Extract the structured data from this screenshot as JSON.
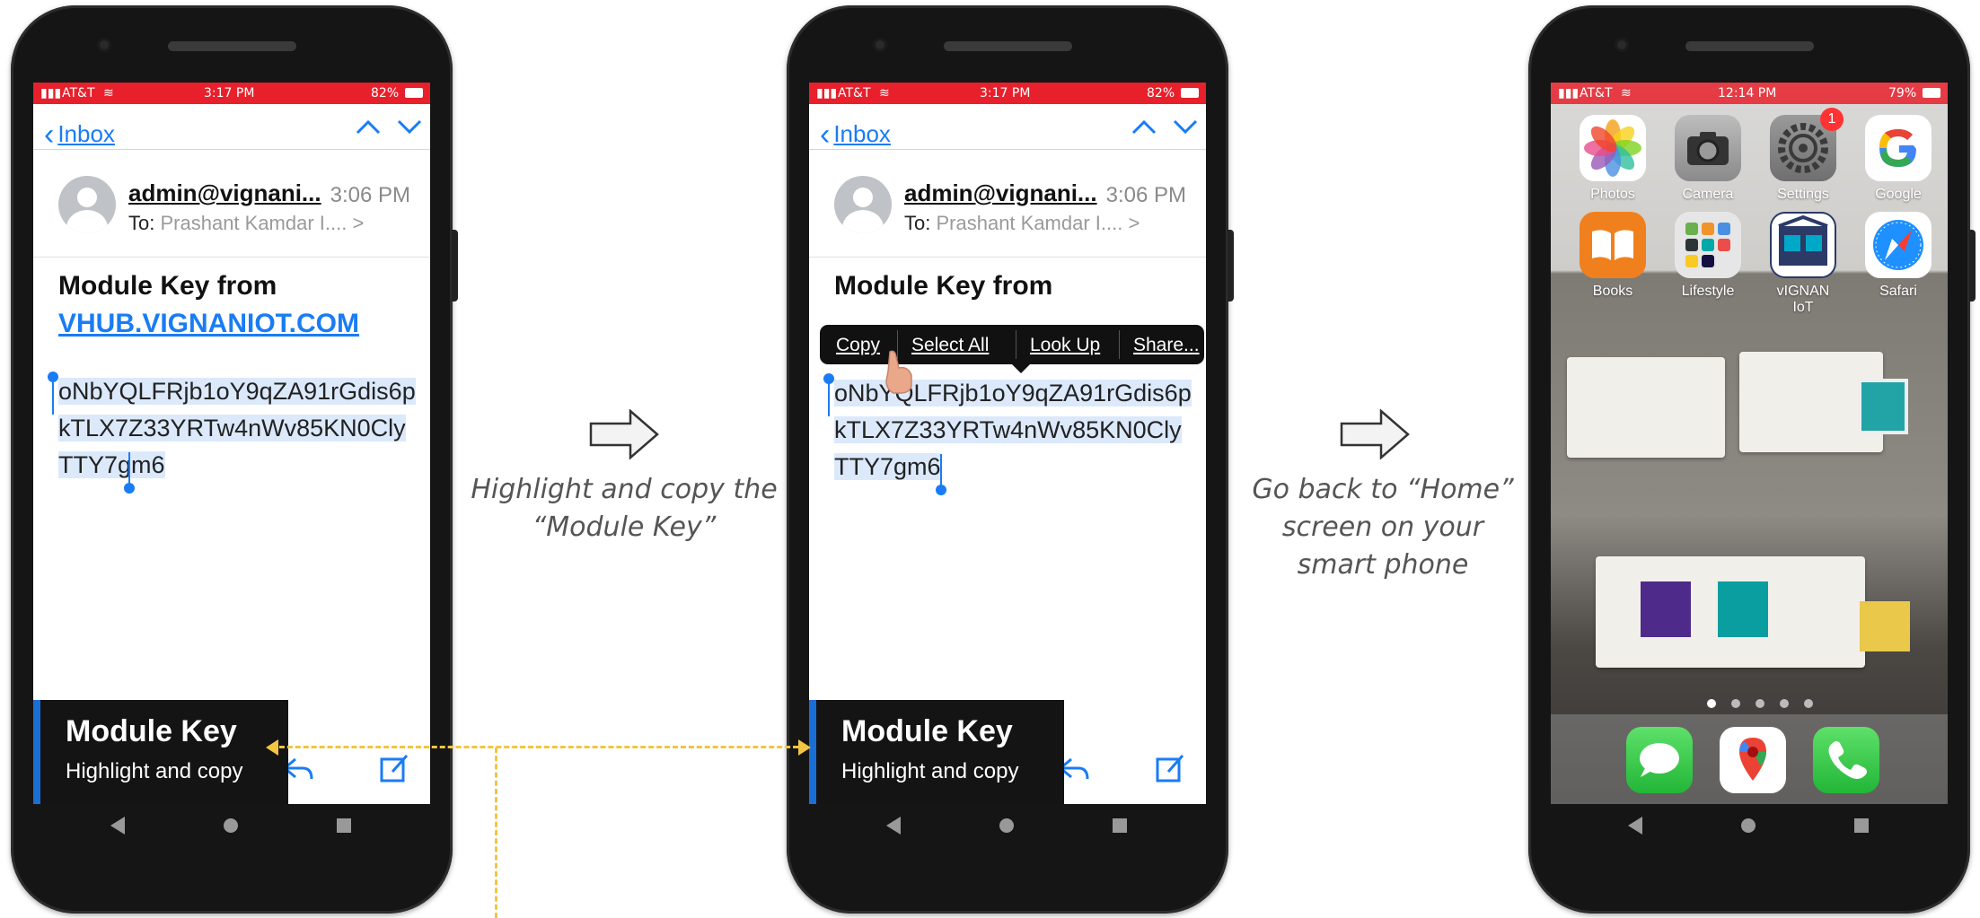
{
  "phones": {
    "email1": {
      "status": {
        "carrier": "AT&T",
        "time": "3:17 PM",
        "battery": "82%"
      },
      "nav": {
        "back_label": "Inbox"
      },
      "email": {
        "from": "admin@vignani...",
        "time": "3:06 PM",
        "to_label": "To:",
        "to_value": "Prashant Kamdar I.... >",
        "subject": "Module Key from",
        "subject_link": "VHUB.VIGNANIOT.COM",
        "key_lines": [
          "oNbYQLFRjb1oY9qZA91rGdis6p",
          "kTLX7Z33YRTw4nWv85KN0Cly",
          "TTY7gm6"
        ]
      },
      "callout": {
        "title": "Module Key",
        "subtitle": "Highlight and copy"
      }
    },
    "email2": {
      "status": {
        "carrier": "AT&T",
        "time": "3:17 PM",
        "battery": "82%"
      },
      "nav": {
        "back_label": "Inbox"
      },
      "email": {
        "from": "admin@vignani...",
        "time": "3:06 PM",
        "to_label": "To:",
        "to_value": "Prashant Kamdar I.... >",
        "subject": "Module Key from",
        "key_lines": [
          "oNbYQLFRjb1oY9qZA91rGdis6p",
          "kTLX7Z33YRTw4nWv85KN0Cly",
          "TTY7gm6"
        ]
      },
      "context_menu": {
        "copy": "Copy",
        "select_all": "Select All",
        "look_up": "Look Up",
        "share": "Share..."
      },
      "callout": {
        "title": "Module Key",
        "subtitle": "Highlight and copy"
      }
    },
    "home": {
      "status": {
        "carrier": "AT&T",
        "time": "12:14 PM",
        "battery": "79%"
      },
      "apps": [
        {
          "label": "Photos",
          "icon": "photos-icon"
        },
        {
          "label": "Camera",
          "icon": "camera-icon"
        },
        {
          "label": "Settings",
          "icon": "settings-icon",
          "badge": "1"
        },
        {
          "label": "Google",
          "icon": "google-icon"
        },
        {
          "label": "Books",
          "icon": "books-icon"
        },
        {
          "label": "Lifestyle",
          "icon": "lifestyle-icon"
        },
        {
          "label": "vIGNAN IoT",
          "icon": "vignan-iot-icon"
        },
        {
          "label": "Safari",
          "icon": "safari-icon"
        }
      ],
      "dock": [
        "messages-icon",
        "maps-icon",
        "phone-icon"
      ]
    }
  },
  "steps": {
    "step1_caption": [
      "Highlight and copy the",
      "“Module Key”"
    ],
    "step2_caption": [
      "Go back to “Home”",
      "screen on your",
      "smart phone"
    ]
  },
  "colors": {
    "accent": "#1a7cf5",
    "status_bar": "#e8202b",
    "callout_bg": "#141414",
    "callout_stripe": "#1a6fd6",
    "dashed_line": "#f2c542"
  }
}
